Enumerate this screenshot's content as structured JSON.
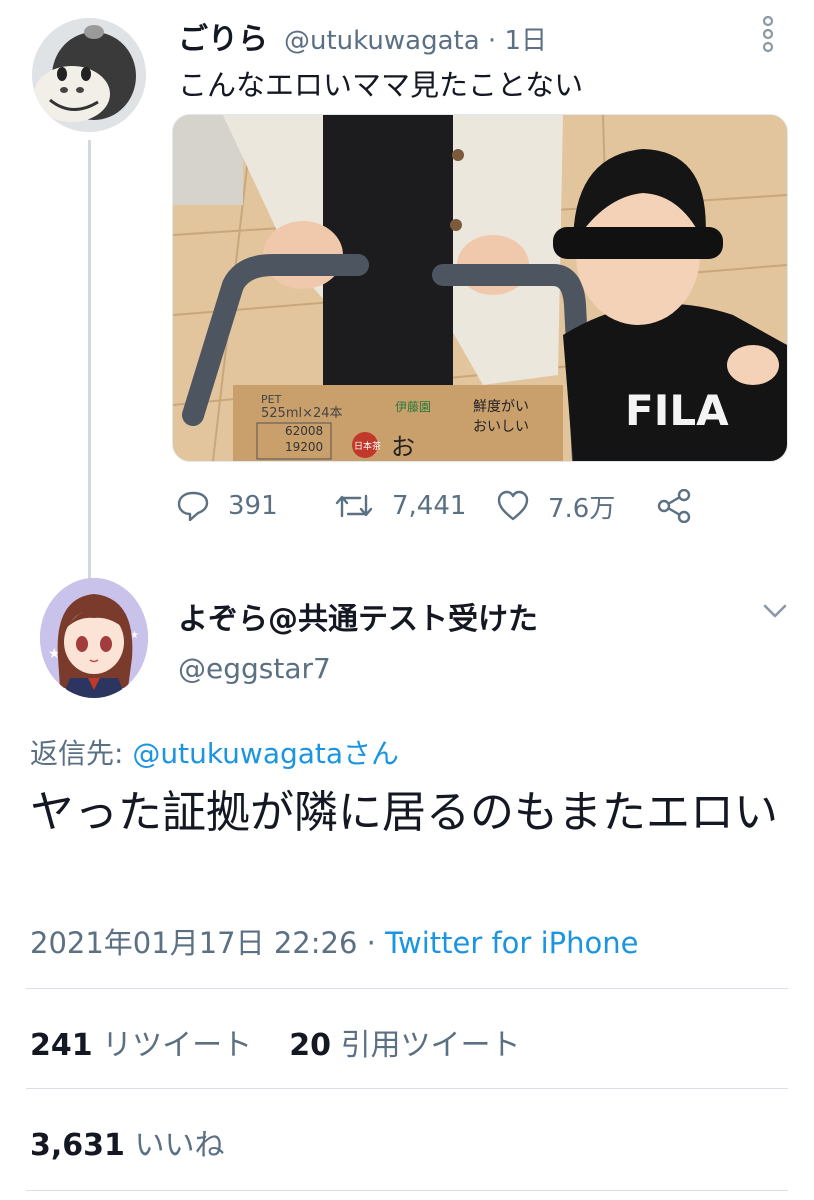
{
  "tweet": {
    "author": {
      "name": "ごりら",
      "handle": "@utukuwagata",
      "time": "1日"
    },
    "separator": "·",
    "text": "こんなエロいママ見たことない",
    "media_text": {
      "box_pet": "PET",
      "box_size": "525ml×24本",
      "box_code1": "62008",
      "box_code2": "19200",
      "box_brand": "伊藤園",
      "box_copy1": "鮮度がい",
      "box_copy2": "おいしい",
      "box_hiragana": "お",
      "box_stamp": "日本茶",
      "shirt_text": "FILA"
    },
    "actions": {
      "replies": "391",
      "retweets": "7,441",
      "likes": "7.6万"
    }
  },
  "reply": {
    "author": {
      "name": "よぞら@共通テスト受けた",
      "handle": "@eggstar7"
    },
    "reply_to_label": "返信先:",
    "reply_to_handle": "@utukuwagataさん",
    "text": "ヤった証拠が隣に居るのもまたエロい",
    "timestamp": "2021年01月17日 22:26",
    "separator": "·",
    "source": "Twitter for iPhone",
    "stats": {
      "retweets_count": "241",
      "retweets_label": "リツイート",
      "quotes_count": "20",
      "quotes_label": "引用ツイート",
      "likes_count": "3,631",
      "likes_label": "いいね"
    }
  },
  "colors": {
    "link": "#1b95e0",
    "muted": "#5b7083",
    "text": "#141823",
    "divider": "#d9dfe4"
  }
}
